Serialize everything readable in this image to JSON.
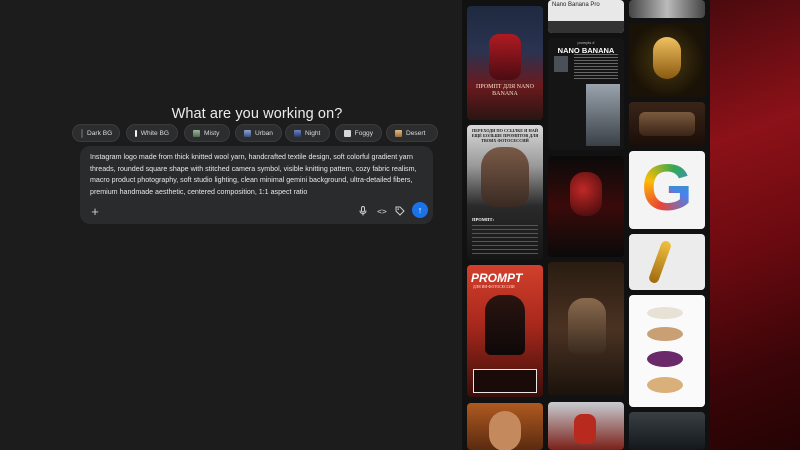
{
  "heading": "What are you working on?",
  "chips": [
    {
      "label": "Dark BG",
      "color": "#111111"
    },
    {
      "label": "White BG",
      "color": "#f2f2f2"
    },
    {
      "label": "Misty",
      "color": "#7a9a7a"
    },
    {
      "label": "Urban",
      "color": "#6b7fb0"
    },
    {
      "label": "Night",
      "color": "#5a6ea8"
    },
    {
      "label": "Foggy",
      "color": "#cfcfcf"
    },
    {
      "label": "Desert",
      "color": "#c9a06a"
    }
  ],
  "prompt": "Instagram logo made from thick knitted wool yarn, handcrafted textile design, soft colorful gradient yarn threads, rounded square shape with stitched camera symbol, visible knitting pattern, cozy fabric realism, macro product photography, soft studio lighting, clean minimal gemini background, ultra-detailed fibers, premium handmade aesthetic, centered composition, 1:1 aspect ratio",
  "toolbar": {
    "plus_glyph": "+",
    "code_glyph": "<>",
    "send_glyph": "↑",
    "icons": {
      "mic": "mic-icon",
      "tag": "tag-icon",
      "send": "arrow-up-icon"
    }
  },
  "gallery": {
    "tile_nano_top": "Nano Banana Pro",
    "tile_spiderman": "ПРОМПТ ДЛЯ NANO BANANA",
    "tile_nano_small": "prompts #",
    "tile_nano_title": "NANO BANANA",
    "tile_russian_header": "ПЕРЕХОДИ ПО ССЫЛКЕ И НАЙ ЕЩЁ БОЛЬШЕ ПРОМПТОВ ДЛЯ ТВОИХ ФОТОСЕССИЙ",
    "tile_prompt_label": "ПРОМПТ:",
    "tile_prompt_big": "PROMPT",
    "tile_prompt_sub": "ДЛЯ ИИ-ФОТОСЕССИИ",
    "tile_google": "G"
  }
}
